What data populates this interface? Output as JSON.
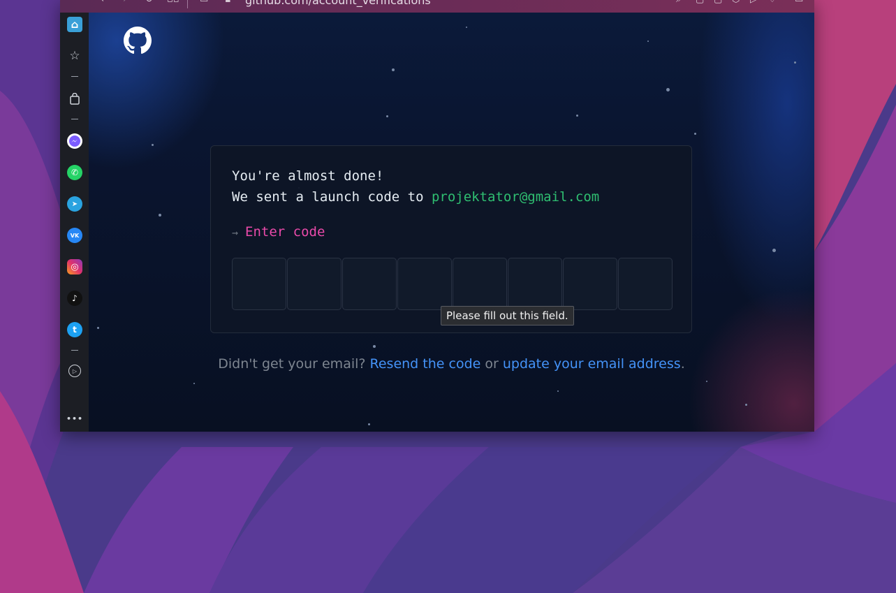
{
  "browser": {
    "url": "github.com/account_verifications"
  },
  "sidebar": {
    "items": [
      {
        "name": "home-icon",
        "glyph": "⌂"
      },
      {
        "name": "bookmarks-icon",
        "glyph": "☆"
      },
      {
        "name": "shopping-bag-icon",
        "glyph": "🛍"
      },
      {
        "name": "messenger-icon",
        "glyph": "m",
        "color": "#7b5cff"
      },
      {
        "name": "whatsapp-icon",
        "glyph": "✆",
        "color": "#25d366"
      },
      {
        "name": "telegram-icon",
        "glyph": "➤",
        "color": "#2aa3e0"
      },
      {
        "name": "vk-icon",
        "glyph": "VK",
        "color": "#2787f5"
      },
      {
        "name": "instagram-icon",
        "glyph": "◎",
        "color": "#e1306c"
      },
      {
        "name": "tiktok-icon",
        "glyph": "♪",
        "color": "#111111"
      },
      {
        "name": "twitter-icon",
        "glyph": "t",
        "color": "#1da1f2"
      },
      {
        "name": "player-icon",
        "glyph": "▷"
      },
      {
        "name": "more-icon",
        "glyph": "•••"
      }
    ]
  },
  "card": {
    "line1": "You're almost done!",
    "line2_prefix": "We sent a launch code to ",
    "email": "projektator@gmail.com",
    "enter_arrow": "→",
    "enter_label": "Enter code",
    "code_boxes": [
      "",
      "",
      "",
      "",
      "",
      "",
      "",
      ""
    ]
  },
  "tooltip": {
    "text": "Please fill out this field."
  },
  "footer": {
    "prefix": "Didn't get your email? ",
    "resend_link": "Resend the code",
    "middle": " or ",
    "update_link": "update your email address",
    "suffix": "."
  },
  "colors": {
    "email": "#2fbf71",
    "enter_code": "#ea4aaa",
    "link": "#4493f8"
  }
}
